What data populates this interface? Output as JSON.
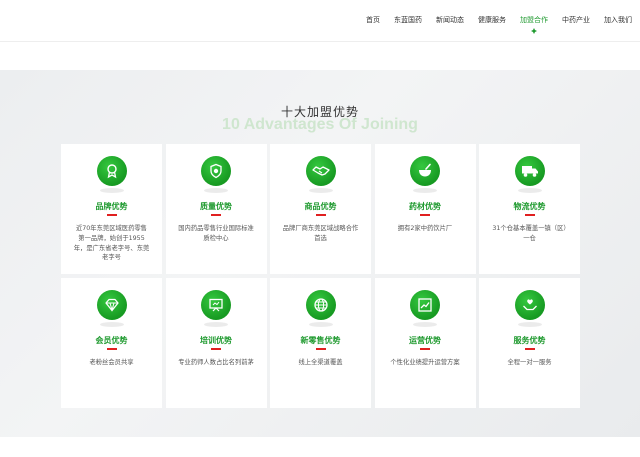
{
  "nav": {
    "items": [
      "首页",
      "东蓝国药",
      "新闻动态",
      "健康服务",
      "加盟合作",
      "中药产业",
      "加入我们"
    ],
    "active_index": 4
  },
  "section": {
    "title_cn": "十大加盟优势",
    "title_en": "10 Advantages Of Joining"
  },
  "cards": [
    {
      "title": "品牌优势",
      "desc": "近70年东莞区域医药零售第一品牌，始创于1955年，是广东省老字号、东莞老字号",
      "icon": "medal-icon"
    },
    {
      "title": "质量优势",
      "desc": "国内药品零售行业国际标准质检中心",
      "icon": "shield-check-icon"
    },
    {
      "title": "商品优势",
      "desc": "品牌厂商东莞区域战略合作首选",
      "icon": "handshake-icon"
    },
    {
      "title": "药材优势",
      "desc": "拥有2家中药饮片厂",
      "icon": "mortar-icon"
    },
    {
      "title": "物流优势",
      "desc": "31个仓基本覆盖一镇（区）一仓",
      "icon": "truck-icon"
    },
    {
      "title": "会员优势",
      "desc": "老粉丝会员共享",
      "icon": "diamond-icon"
    },
    {
      "title": "培训优势",
      "desc": "专业药师人数占比名列前茅",
      "icon": "presentation-icon"
    },
    {
      "title": "新零售优势",
      "desc": "线上全渠道覆盖",
      "icon": "globe-icon"
    },
    {
      "title": "运营优势",
      "desc": "个性化业绩提升运营方案",
      "icon": "chart-icon"
    },
    {
      "title": "服务优势",
      "desc": "全程一对一服务",
      "icon": "care-hands-icon"
    }
  ],
  "colors": {
    "brand_green": "#1f9a2f",
    "accent_red": "#e02020"
  }
}
